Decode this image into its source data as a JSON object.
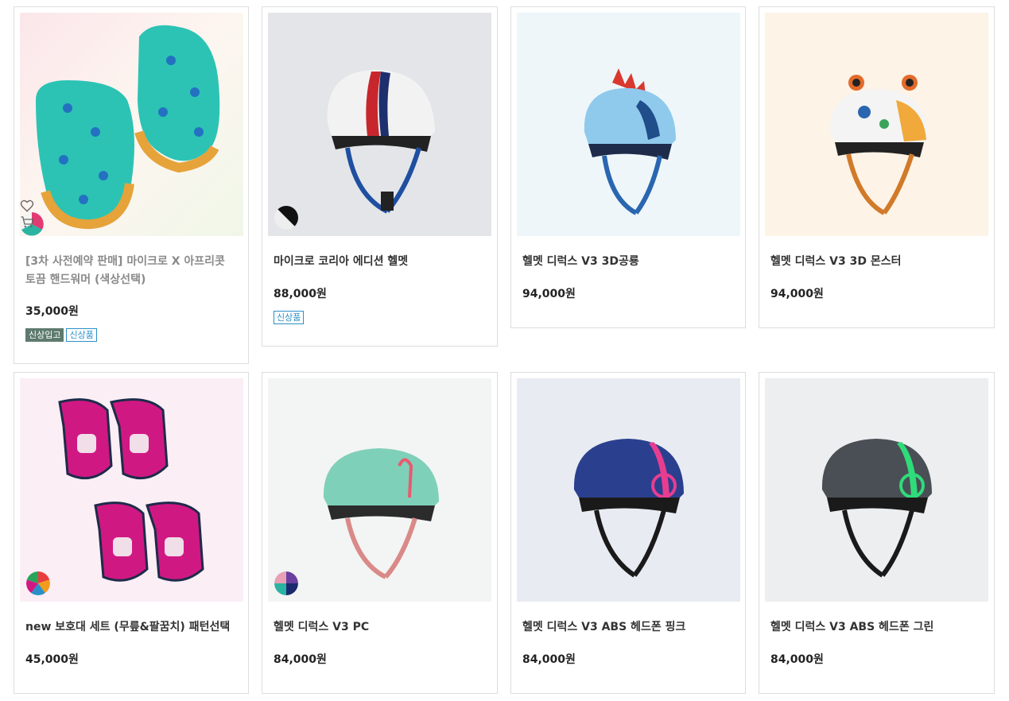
{
  "products": [
    {
      "title": "[3차 사전예약 판매] 마이크로 X 아프리콧 토끔 핸드워머 (색상선택)",
      "price": "35,000원",
      "badges": [
        "신상입고",
        "신상품"
      ],
      "bg": "#fbeef0",
      "accent": "#27c7b5",
      "swatch_colors": [
        "#e23a73",
        "#2ab3a0",
        "#f4f4f4"
      ]
    },
    {
      "title": "마이크로 코리아 에디션 헬멧",
      "price": "88,000원",
      "badges": [
        "신상품"
      ],
      "bg": "#e3e5e9",
      "accent": "#f2f2f2",
      "swatch_colors": [
        "#111111",
        "#eeeeee"
      ]
    },
    {
      "title": "헬멧 디럭스 V3 3D공룡",
      "price": "94,000원",
      "badges": [],
      "bg": "#eef6fa",
      "accent": "#8fc9ec",
      "swatch_colors": []
    },
    {
      "title": "헬멧 디럭스 V3 3D 몬스터",
      "price": "94,000원",
      "badges": [],
      "bg": "#fdf3e6",
      "accent": "#f4f4f4",
      "swatch_colors": []
    },
    {
      "title": "new 보호대 세트 (무릎&팔꿈치) 패턴선택",
      "price": "45,000원",
      "badges": [],
      "bg": "#fbeef5",
      "accent": "#d01883",
      "swatch_colors": [
        "#e83d3d",
        "#f39c1c",
        "#2a8fc7",
        "#d01883",
        "#28a55a"
      ]
    },
    {
      "title": "헬멧 디럭스 V3 PC",
      "price": "84,000원",
      "badges": [],
      "bg": "#f3f4f4",
      "accent": "#7fd0b8",
      "swatch_colors": [
        "#6a3fa0",
        "#2ab3a0",
        "#1b2a6e",
        "#e8a0b5"
      ]
    },
    {
      "title": "헬멧 디럭스 V3 ABS 헤드폰 핑크",
      "price": "84,000원",
      "badges": [],
      "bg": "#e8ecf2",
      "accent": "#2b3f8f",
      "swatch_colors": []
    },
    {
      "title": "헬멧 디럭스 V3 ABS 헤드폰 그린",
      "price": "84,000원",
      "badges": [],
      "bg": "#eceef0",
      "accent": "#4a4f55",
      "swatch_colors": []
    }
  ]
}
